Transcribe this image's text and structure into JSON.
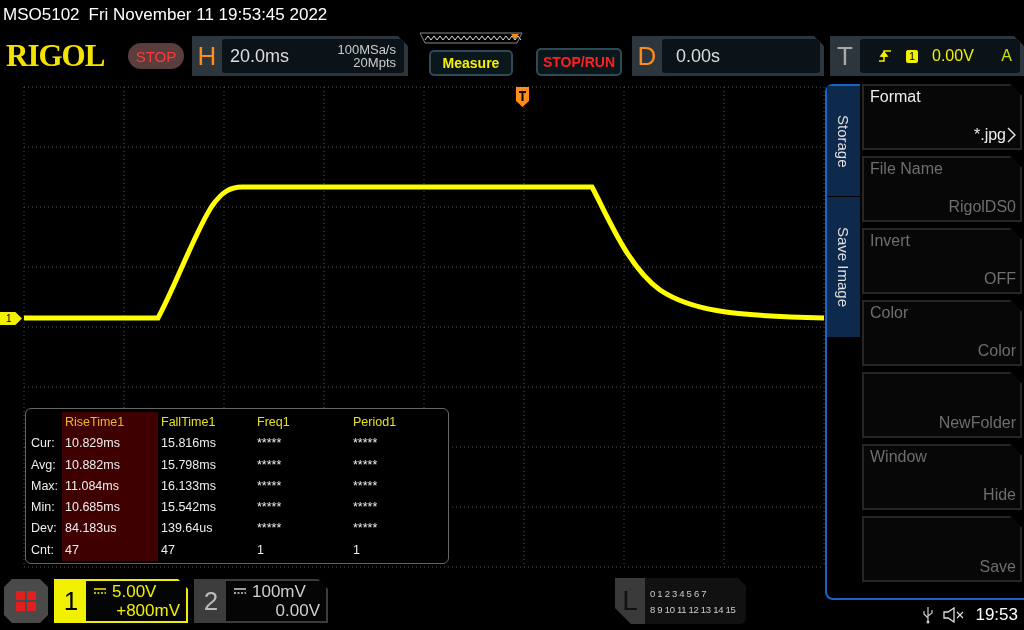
{
  "header": {
    "model": "MSO5102",
    "datetime": "Fri November 11 19:53:45 2022"
  },
  "toolbar": {
    "logo": "RIGOL",
    "run_state": "STOP",
    "horizontal": {
      "label": "H",
      "timebase": "20.0ms",
      "sample_rate": "100MSa/s",
      "memory_depth": "20Mpts"
    },
    "buttons": [
      {
        "label": "Measure",
        "kind": "measure"
      },
      {
        "label": "STOP/RUN",
        "kind": "run"
      }
    ],
    "delay": {
      "label": "D",
      "value": "0.00s"
    },
    "trigger": {
      "label": "T",
      "source": "1",
      "threshold": "0.00V",
      "mode": "A"
    }
  },
  "display": {
    "channel_marker": "1",
    "measurements": {
      "columns": [
        {
          "name": "RiseTime1",
          "selected": true
        },
        {
          "name": "FallTime1",
          "selected": false
        },
        {
          "name": "Freq1",
          "selected": false
        },
        {
          "name": "Period1",
          "selected": false
        }
      ],
      "rows": [
        {
          "label": "Cur:",
          "values": [
            "10.829ms",
            "15.816ms",
            "*****",
            "*****"
          ]
        },
        {
          "label": "Avg:",
          "values": [
            "10.882ms",
            "15.798ms",
            "*****",
            "*****"
          ]
        },
        {
          "label": "Max:",
          "values": [
            "11.084ms",
            "16.133ms",
            "*****",
            "*****"
          ]
        },
        {
          "label": "Min:",
          "values": [
            "10.685ms",
            "15.542ms",
            "*****",
            "*****"
          ]
        },
        {
          "label": "Dev:",
          "values": [
            "84.183us",
            "139.64us",
            "*****",
            "*****"
          ]
        },
        {
          "label": "Cnt:",
          "values": [
            "47",
            "47",
            "1",
            "1"
          ]
        }
      ]
    }
  },
  "side_menu": {
    "tabs": [
      {
        "label": "Storage"
      },
      {
        "label": "Save Image"
      }
    ],
    "items": [
      {
        "label": "Format",
        "value": "*.jpg",
        "disabled": false,
        "submenu": true
      },
      {
        "label": "File Name",
        "value": "RigolDS0",
        "disabled": true
      },
      {
        "label": "Invert",
        "value": "OFF",
        "disabled": true
      },
      {
        "label": "Color",
        "value": "Color",
        "disabled": true
      },
      {
        "value": "NewFolder",
        "disabled": true
      },
      {
        "label": "Window",
        "value": "Hide",
        "disabled": true
      },
      {
        "value": "Save",
        "disabled": true
      }
    ]
  },
  "channels": [
    {
      "number": "1",
      "scale": "5.00V",
      "offset": "+800mV",
      "active": true
    },
    {
      "number": "2",
      "scale": "100mV",
      "offset": "0.00V",
      "active": false
    }
  ],
  "logic": {
    "label": "L",
    "bits_low": "0 1 2 3 4 5 6 7",
    "bits_high": "8 9 10 11 12 13 14 15"
  },
  "status": {
    "sound_muted": true,
    "time": "19:53"
  }
}
